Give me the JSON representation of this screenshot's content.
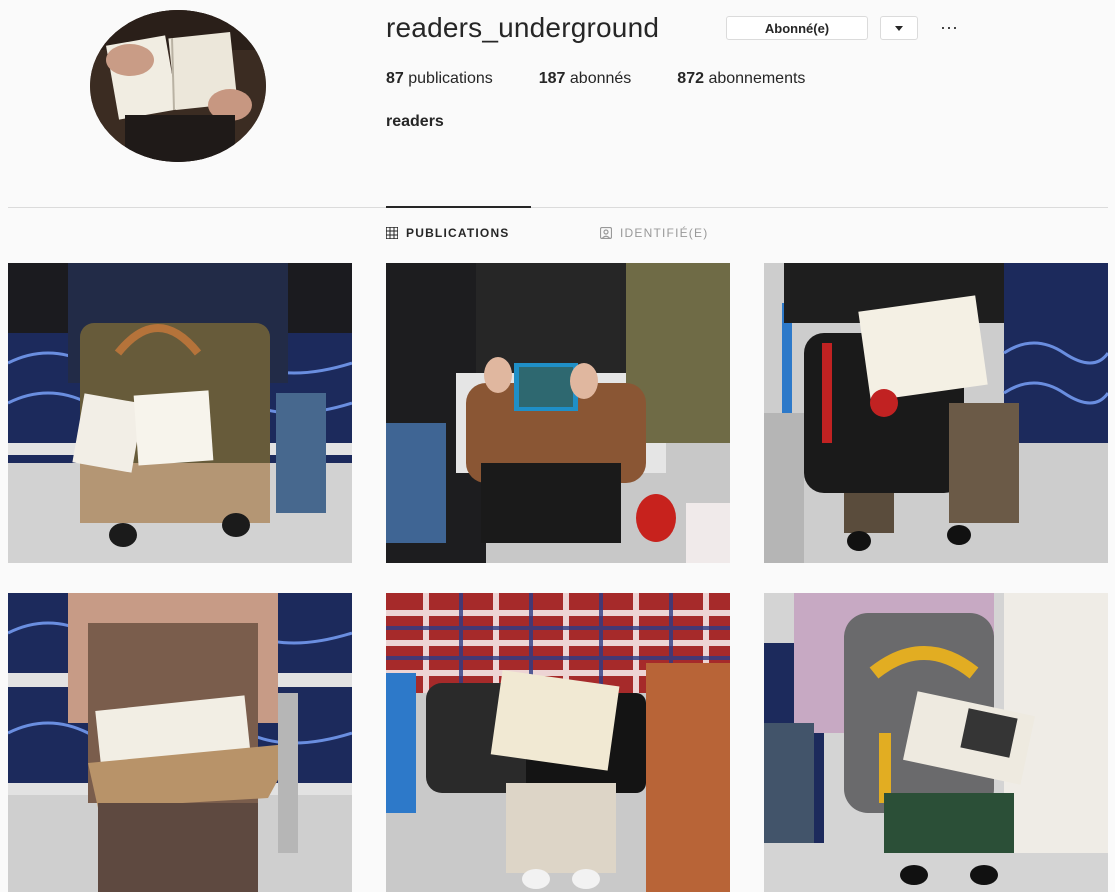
{
  "profile": {
    "username": "readers_underground",
    "follow_button": "Abonné(e)",
    "more_label": "···",
    "bio": "readers",
    "stats": [
      {
        "count": "87",
        "label": "publications"
      },
      {
        "count": "187",
        "label": "abonnés"
      },
      {
        "count": "872",
        "label": "abonnements"
      }
    ]
  },
  "tabs": [
    {
      "label": "PUBLICATIONS",
      "icon": "grid-icon",
      "active": true
    },
    {
      "label": "IDENTIFIÉ(E)",
      "icon": "tagged-icon",
      "active": false
    }
  ],
  "posts": [
    {
      "alt": "reader with tan bag and book",
      "bg": "#6f6a6a"
    },
    {
      "alt": "reader with e-reader and brown bag",
      "bg": "#5b5859"
    },
    {
      "alt": "reader with black backpack and book",
      "bg": "#6a6766"
    },
    {
      "alt": "reader in spaghetti top with book",
      "bg": "#6b6769"
    },
    {
      "alt": "reader in plaid shirt with book",
      "bg": "#5e5c5e"
    },
    {
      "alt": "reader in pink sweater with book",
      "bg": "#6e6b6c"
    }
  ]
}
